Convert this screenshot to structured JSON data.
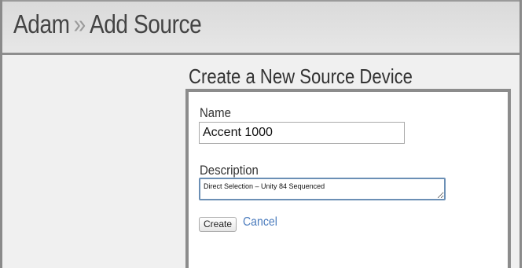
{
  "header": {
    "breadcrumb_parent": "Adam",
    "breadcrumb_separator": "»",
    "breadcrumb_current": "Add Source"
  },
  "form": {
    "heading": "Create a New Source Device",
    "name_label": "Name",
    "name_value": "Accent 1000",
    "description_label": "Description",
    "description_value": "Direct Selection – Unity 84 Sequenced",
    "create_label": "Create",
    "cancel_label": "Cancel"
  },
  "colors": {
    "link": "#4a7bbd",
    "frame_border": "#8a8a8a",
    "focus_border": "#6b8fb5"
  }
}
